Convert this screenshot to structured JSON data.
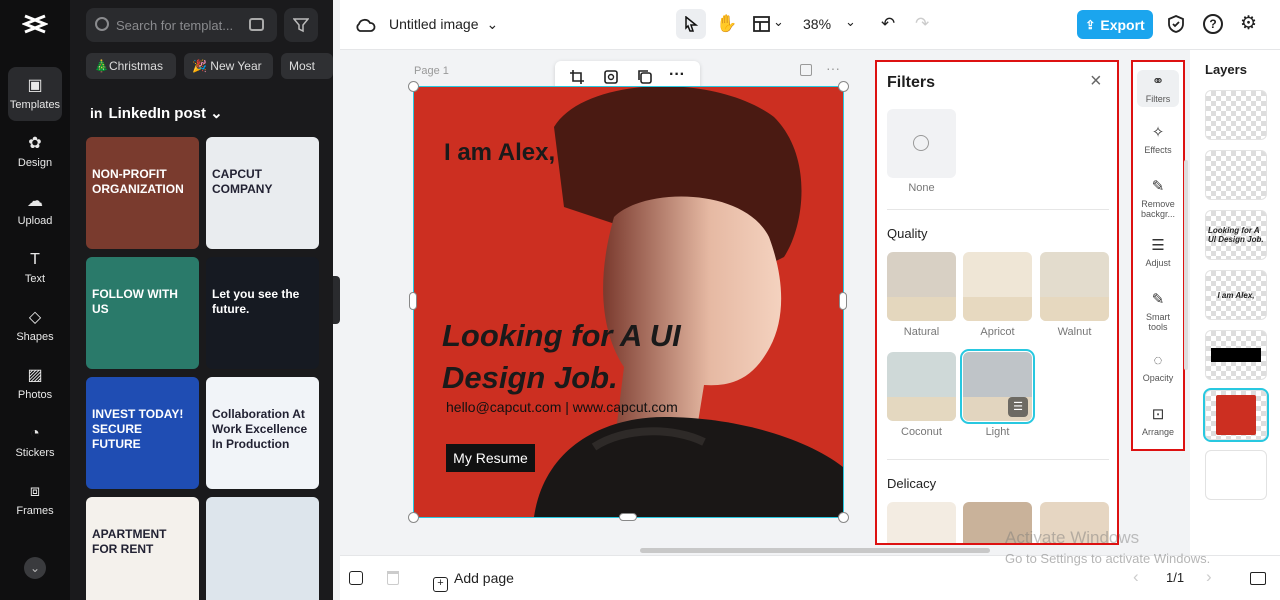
{
  "rail": [
    {
      "label": "Templates",
      "icon": "templates-icon",
      "active": true
    },
    {
      "label": "Design",
      "icon": "design-icon"
    },
    {
      "label": "Upload",
      "icon": "upload-icon"
    },
    {
      "label": "Text",
      "icon": "text-icon"
    },
    {
      "label": "Shapes",
      "icon": "shapes-icon"
    },
    {
      "label": "Photos",
      "icon": "photos-icon"
    },
    {
      "label": "Stickers",
      "icon": "stickers-icon"
    },
    {
      "label": "Frames",
      "icon": "frames-icon"
    }
  ],
  "templates": {
    "search_placeholder": "Search for templat...",
    "chips": [
      "🎄Christmas",
      "🎉 New Year",
      "Most"
    ],
    "category": "LinkedIn post",
    "cards": [
      {
        "text": "NON-PROFIT ORGANIZATION",
        "bg": "#7a3b2e"
      },
      {
        "text": "CAPCUT COMPANY",
        "bg": "#e9ecef"
      },
      {
        "text": "FOLLOW WITH US",
        "bg": "#2a7a6a"
      },
      {
        "text": "Let you see the future.",
        "bg": "#161a22"
      },
      {
        "text": "INVEST TODAY! SECURE FUTURE",
        "bg": "#1f4db3"
      },
      {
        "text": "Collaboration At Work Excellence In Production",
        "bg": "#f1f4f8"
      },
      {
        "text": "APARTMENT FOR RENT",
        "bg": "#f4f1ec"
      },
      {
        "text": "",
        "bg": "#dde5ec"
      }
    ]
  },
  "topbar": {
    "doc_title": "Untitled image",
    "zoom": "38%",
    "export_label": "Export"
  },
  "canvas": {
    "page_label": "Page 1",
    "name_text": "I am Alex,",
    "headline": "Looking for A UI Design Job.",
    "contact": "hello@capcut.com | www.capcut.com",
    "button": "My Resume"
  },
  "filters": {
    "title": "Filters",
    "none_label": "None",
    "quality_title": "Quality",
    "quality": [
      {
        "label": "Natural",
        "bg": "#d8d0c4"
      },
      {
        "label": "Apricot",
        "bg": "#efe6d6"
      },
      {
        "label": "Walnut",
        "bg": "#e3dccd"
      },
      {
        "label": "Coconut",
        "bg": "#cfd9d8"
      },
      {
        "label": "Light",
        "bg": "#bfc4c8"
      }
    ],
    "delicacy_title": "Delicacy",
    "delicacy": [
      {
        "bg": "#f3ece2"
      },
      {
        "bg": "#c9b29a"
      },
      {
        "bg": "#e6d6c2"
      }
    ]
  },
  "tools": [
    {
      "label": "Filters",
      "icon": "filters-icon"
    },
    {
      "label": "Effects",
      "icon": "effects-icon"
    },
    {
      "label": "Remove backgr...",
      "icon": "remove-background-icon"
    },
    {
      "label": "Adjust",
      "icon": "adjust-icon"
    },
    {
      "label": "Smart tools",
      "icon": "smart-tools-icon"
    },
    {
      "label": "Opacity",
      "icon": "opacity-icon"
    },
    {
      "label": "Arrange",
      "icon": "arrange-icon"
    }
  ],
  "layers": {
    "title": "Layers",
    "items": [
      {
        "text": ""
      },
      {
        "text": ""
      },
      {
        "text": "Looking for A UI Design Job."
      },
      {
        "text": "I am Alex,"
      },
      {
        "text": ""
      },
      {
        "text": ""
      },
      {
        "text": ""
      }
    ]
  },
  "bottombar": {
    "add_page": "Add page",
    "pager": "1/1"
  },
  "watermark": {
    "line1": "Activate Windows",
    "line2": "Go to Settings to activate Windows."
  }
}
